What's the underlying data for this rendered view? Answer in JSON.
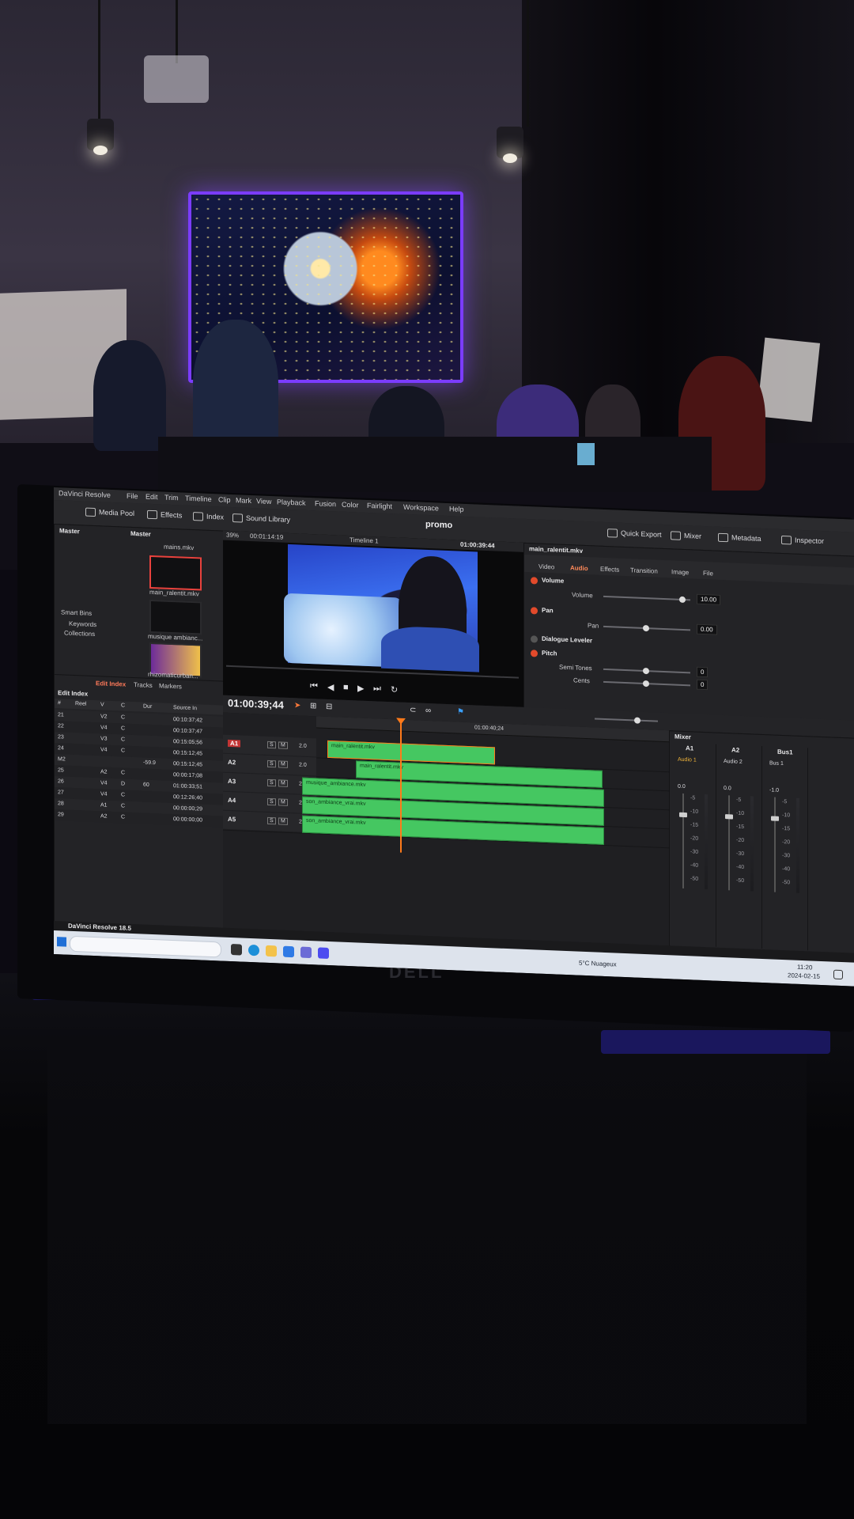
{
  "scene": {
    "projection_title": "",
    "laptop_brand": "DELL"
  },
  "app": {
    "menu": [
      "DaVinci Resolve",
      "File",
      "Edit",
      "Trim",
      "Timeline",
      "Clip",
      "Mark",
      "View",
      "Playback",
      "Fusion",
      "Color",
      "Fairlight",
      "Workspace",
      "Help"
    ],
    "toolbar": {
      "media_pool": "Media Pool",
      "effects": "Effects",
      "index": "Index",
      "sound_library": "Sound Library",
      "project_title": "promo",
      "quick_export": "Quick Export",
      "mixer": "Mixer",
      "metadata": "Metadata",
      "inspector": "Inspector"
    },
    "viewer_bar": {
      "zoom": "39%",
      "duration": "00:01:14:19",
      "timeline_name": "Timeline 1",
      "timecode": "01:00:39:44",
      "clip_name": "main_ralentit.mkv"
    },
    "media_pool": {
      "master_label": "Master",
      "bin_label": "Master",
      "smart_bins": "Smart Bins",
      "keywords": "Keywords",
      "collections": "Collections",
      "clips": [
        {
          "name": "main_ralentit.mkv",
          "selected": true
        },
        {
          "name": "musique ambianc...",
          "selected": false
        },
        {
          "name": "rhizomaticurban...",
          "selected": false
        }
      ],
      "top_clip": "mains.mkv"
    },
    "edit_index": {
      "tabs": [
        "Edit Index",
        "Tracks",
        "Markers"
      ],
      "title": "Edit Index",
      "headers": [
        "#",
        "Reel",
        "V",
        "C",
        "Dur",
        "Source In"
      ],
      "rows": [
        {
          "n": "21",
          "reel": "",
          "v": "V2",
          "c": "C",
          "dur": "",
          "src": "00:10:37;42"
        },
        {
          "n": "22",
          "reel": "",
          "v": "V4",
          "c": "C",
          "dur": "",
          "src": "00:10:37;47"
        },
        {
          "n": "23",
          "reel": "",
          "v": "V3",
          "c": "C",
          "dur": "",
          "src": "00:15:05;56"
        },
        {
          "n": "24",
          "reel": "",
          "v": "V4",
          "c": "C",
          "dur": "",
          "src": "00:15:12;45"
        },
        {
          "n": "M2",
          "reel": "",
          "v": "",
          "c": "",
          "dur": "-59.9",
          "src": "00:15:12;45"
        },
        {
          "n": "25",
          "reel": "",
          "v": "A2",
          "c": "C",
          "dur": "",
          "src": "00:00:17;08"
        },
        {
          "n": "26",
          "reel": "",
          "v": "V4",
          "c": "D",
          "dur": "60",
          "src": "01:00:33;51"
        },
        {
          "n": "27",
          "reel": "",
          "v": "V4",
          "c": "C",
          "dur": "",
          "src": "00:12:26;40"
        },
        {
          "n": "28",
          "reel": "",
          "v": "A1",
          "c": "C",
          "dur": "",
          "src": "00:00:00;29"
        },
        {
          "n": "29",
          "reel": "",
          "v": "A2",
          "c": "C",
          "dur": "",
          "src": "00:00:00;00"
        }
      ]
    },
    "timeline": {
      "timecode": "01:00:39;44",
      "ruler_mark": "01:00:40;24",
      "tracks": [
        {
          "id": "A1",
          "level": "2.0",
          "clips": [
            {
              "name": "main_ralentit.mkv"
            }
          ]
        },
        {
          "id": "A2",
          "level": "2.0",
          "clips": [
            {
              "name": "main_ralentit.mkv"
            }
          ]
        },
        {
          "id": "A3",
          "level": "2.0",
          "clips": [
            {
              "name": "musique_ambiance.mkv"
            }
          ]
        },
        {
          "id": "A4",
          "level": "2.0",
          "clips": [
            {
              "name": "son_ambiance_vrai.mkv"
            }
          ]
        },
        {
          "id": "A5",
          "level": "2.0",
          "clips": [
            {
              "name": "son_ambiance_vrai.mkv"
            }
          ]
        }
      ],
      "track_buttons": [
        "S",
        "M"
      ]
    },
    "inspector": {
      "tabs": [
        "Video",
        "Audio",
        "Effects",
        "Transition",
        "Image",
        "File"
      ],
      "active_tab": "Audio",
      "sections": {
        "volume": {
          "label": "Volume",
          "param": "Volume",
          "value": "10.00"
        },
        "pan": {
          "label": "Pan",
          "param": "Pan",
          "value": "0.00"
        },
        "dialogue_leveler": "Dialogue Leveler",
        "pitch": {
          "label": "Pitch",
          "semi_label": "Semi Tones",
          "semi_value": "0",
          "cents_label": "Cents",
          "cents_value": "0"
        }
      }
    },
    "mixer": {
      "title": "Mixer",
      "channels": [
        "A1",
        "A2",
        "Bus1"
      ],
      "strip_labels": [
        "Audio 1",
        "Audio 2",
        "Bus 1"
      ],
      "values": [
        "0.0",
        "0.0",
        "-1.0"
      ],
      "scale": [
        "-5",
        "-10",
        "-15",
        "-20",
        "-30",
        "-40",
        "-50"
      ]
    },
    "statusbar": {
      "app_version": "DaVinci Resolve 18.5"
    },
    "taskbar": {
      "weather": "5°C Nuageux",
      "time": "11:20",
      "date": "2024-02-15"
    }
  }
}
